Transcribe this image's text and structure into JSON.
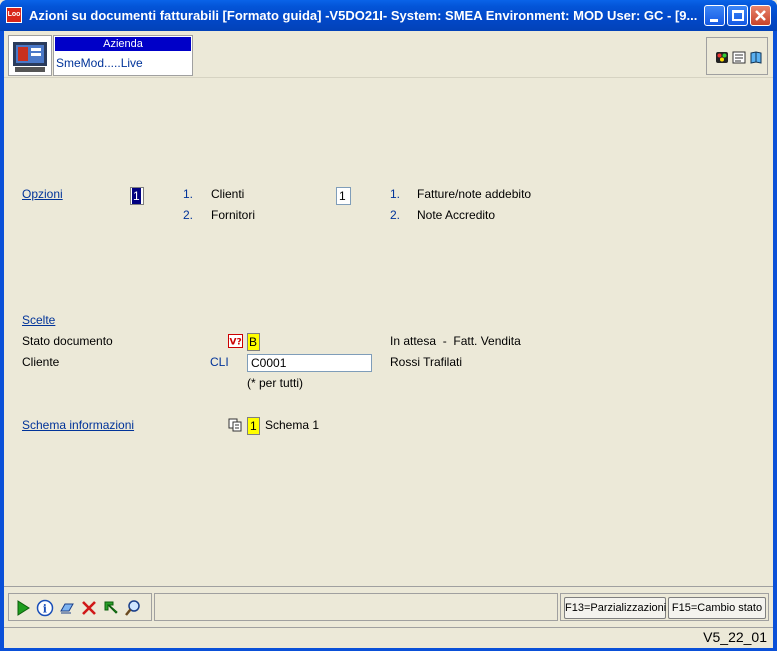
{
  "window": {
    "title": "Azioni su documenti fatturabili [Formato guida] -V5DO21I- System: SMEA Environment: MOD User: GC - [9...",
    "app_icon_text": "Loo"
  },
  "header": {
    "azienda_label": "Azienda",
    "azienda_value": "SmeMod.....Live"
  },
  "opzioni": {
    "label": "Opzioni",
    "value": "1",
    "list1": [
      {
        "num": "1.",
        "label": "Clienti"
      },
      {
        "num": "2.",
        "label": "Fornitori"
      }
    ],
    "value2": "1",
    "list2": [
      {
        "num": "1.",
        "label": "Fatture/note addebito"
      },
      {
        "num": "2.",
        "label": "Note Accredito"
      }
    ]
  },
  "scelte": {
    "label": "Scelte",
    "stato_label": "Stato documento",
    "stato_value": "B",
    "stato_desc": "In attesa  -  Fatt. Vendita",
    "cliente_label": "Cliente",
    "cliente_code_prefix": "CLI",
    "cliente_value": "C0001",
    "cliente_hint": "(* per tutti)",
    "cliente_desc": "Rossi Trafilati"
  },
  "schema": {
    "label": "Schema informazioni",
    "value": "1",
    "desc": "Schema 1"
  },
  "footer": {
    "f13": "F13=Parzializzazioni",
    "f15": "F15=Cambio stato",
    "version": "V5_22_01"
  },
  "colors": {
    "title_bar": "#0a50d8",
    "background": "#ece9d8",
    "link": "#003399",
    "yellow_field": "#ffff00"
  }
}
